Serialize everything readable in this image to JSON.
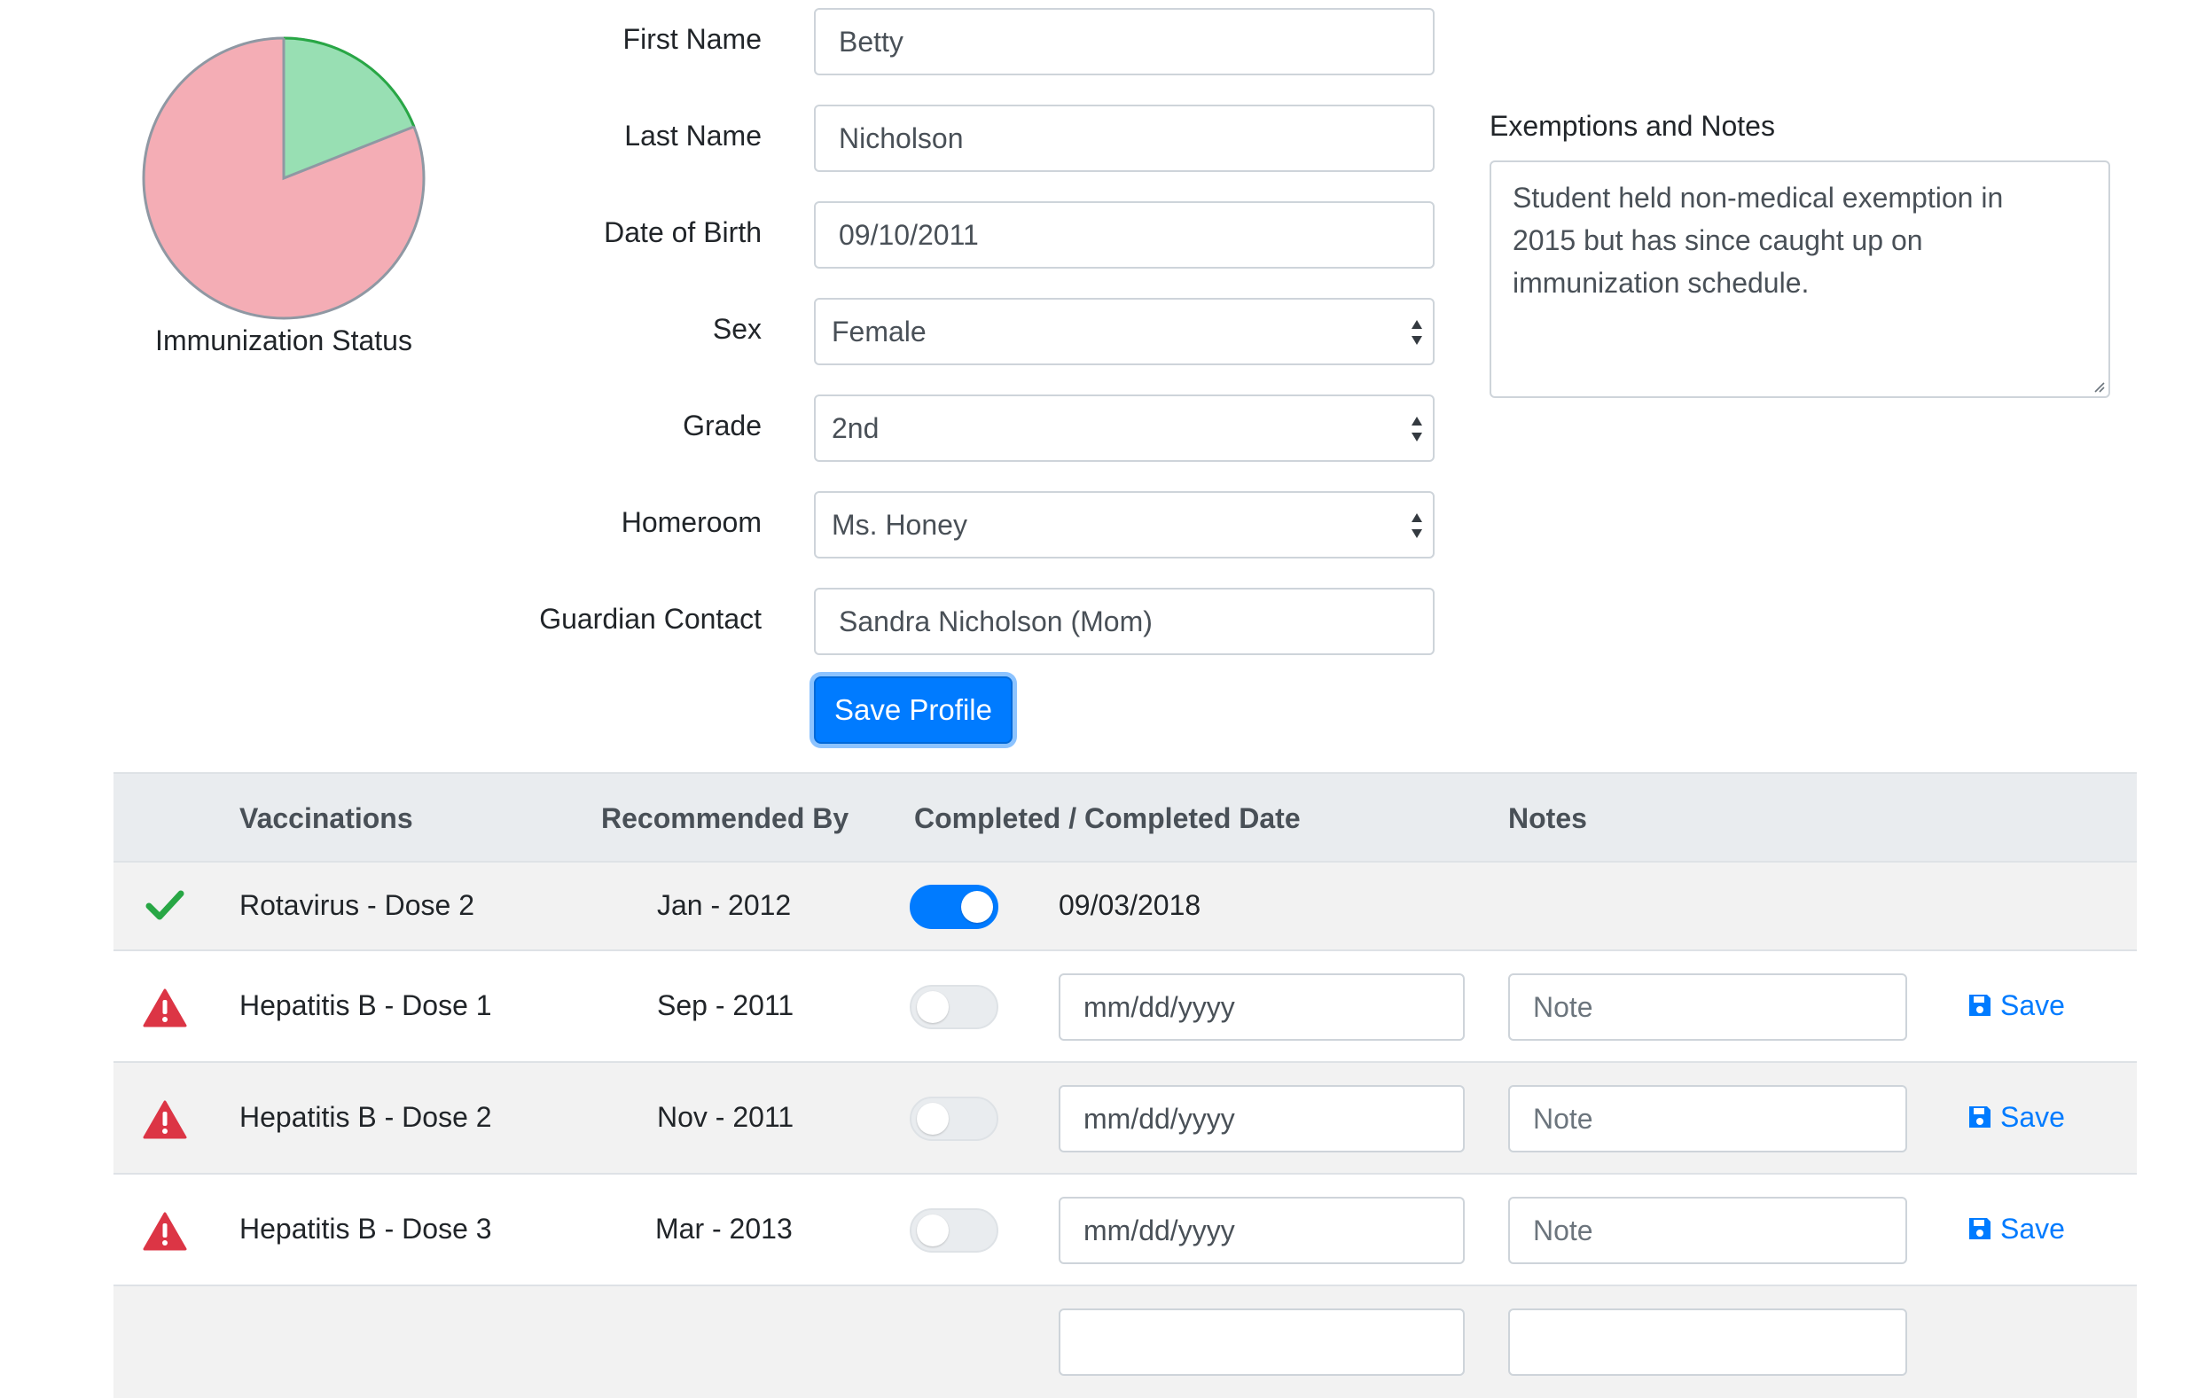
{
  "pie": {
    "caption": "Immunization Status",
    "completed_fraction": 0.19,
    "colors": {
      "completed": "#98dfb3",
      "completed_edge": "#28a745",
      "pending": "#f4adb5",
      "outline": "#8f98a3"
    }
  },
  "form": {
    "first_name": {
      "label": "First Name",
      "value": "Betty"
    },
    "last_name": {
      "label": "Last Name",
      "value": "Nicholson"
    },
    "dob": {
      "label": "Date of Birth",
      "value": "09/10/2011"
    },
    "sex": {
      "label": "Sex",
      "value": "Female"
    },
    "grade": {
      "label": "Grade",
      "value": "2nd"
    },
    "homeroom": {
      "label": "Homeroom",
      "value": "Ms. Honey"
    },
    "guardian": {
      "label": "Guardian Contact",
      "value": "Sandra Nicholson (Mom)"
    },
    "save_label": "Save Profile"
  },
  "exemptions": {
    "label": "Exemptions and Notes",
    "lines": [
      "Student held non-medical exemption in",
      "2015 but has since caught up on",
      "immunization schedule."
    ]
  },
  "table": {
    "headers": {
      "vaccinations": "Vaccinations",
      "recommended_by": "Recommended By",
      "completed": "Completed / Completed Date",
      "notes": "Notes"
    },
    "rows": [
      {
        "status": "check-icon",
        "name": "Rotavirus - Dose 2",
        "recommended": "Jan - 2012",
        "completed": true,
        "date": "09/03/2018"
      },
      {
        "status": "warning-icon",
        "name": "Hepatitis B - Dose 1",
        "recommended": "Sep - 2011",
        "completed": false,
        "date_placeholder": "mm/dd/yyyy",
        "note_placeholder": "Note",
        "save_label": "Save"
      },
      {
        "status": "warning-icon",
        "name": "Hepatitis B - Dose 2",
        "recommended": "Nov - 2011",
        "completed": false,
        "date_placeholder": "mm/dd/yyyy",
        "note_placeholder": "Note",
        "save_label": "Save"
      },
      {
        "status": "warning-icon",
        "name": "Hepatitis B - Dose 3",
        "recommended": "Mar - 2013",
        "completed": false,
        "date_placeholder": "mm/dd/yyyy",
        "note_placeholder": "Note",
        "save_label": "Save"
      }
    ]
  },
  "colors": {
    "primary": "#007bff",
    "success": "#28a745",
    "danger": "#dc3545",
    "header_bg": "#e9ecef"
  }
}
